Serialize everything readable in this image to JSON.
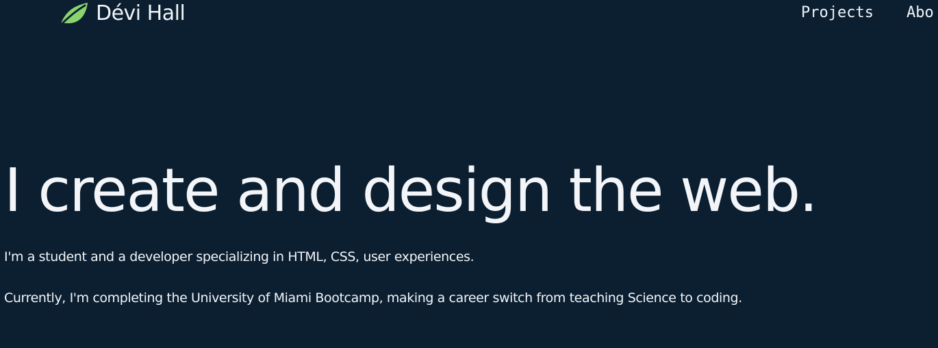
{
  "colors": {
    "background": "#0b1f31",
    "text": "#f3f5f8",
    "logo": "#8bd36e"
  },
  "header": {
    "logo_icon": "leaf-icon",
    "brand_name": "Dévi Hall",
    "nav_links": [
      "Projects",
      "Abo"
    ]
  },
  "hero": {
    "title": "I create and design the web.",
    "intro": "I'm a student and a developer specializing in HTML, CSS, user experiences.",
    "current": "Currently, I'm completing the University of Miami Bootcamp, making a career switch from teaching Science to coding."
  }
}
